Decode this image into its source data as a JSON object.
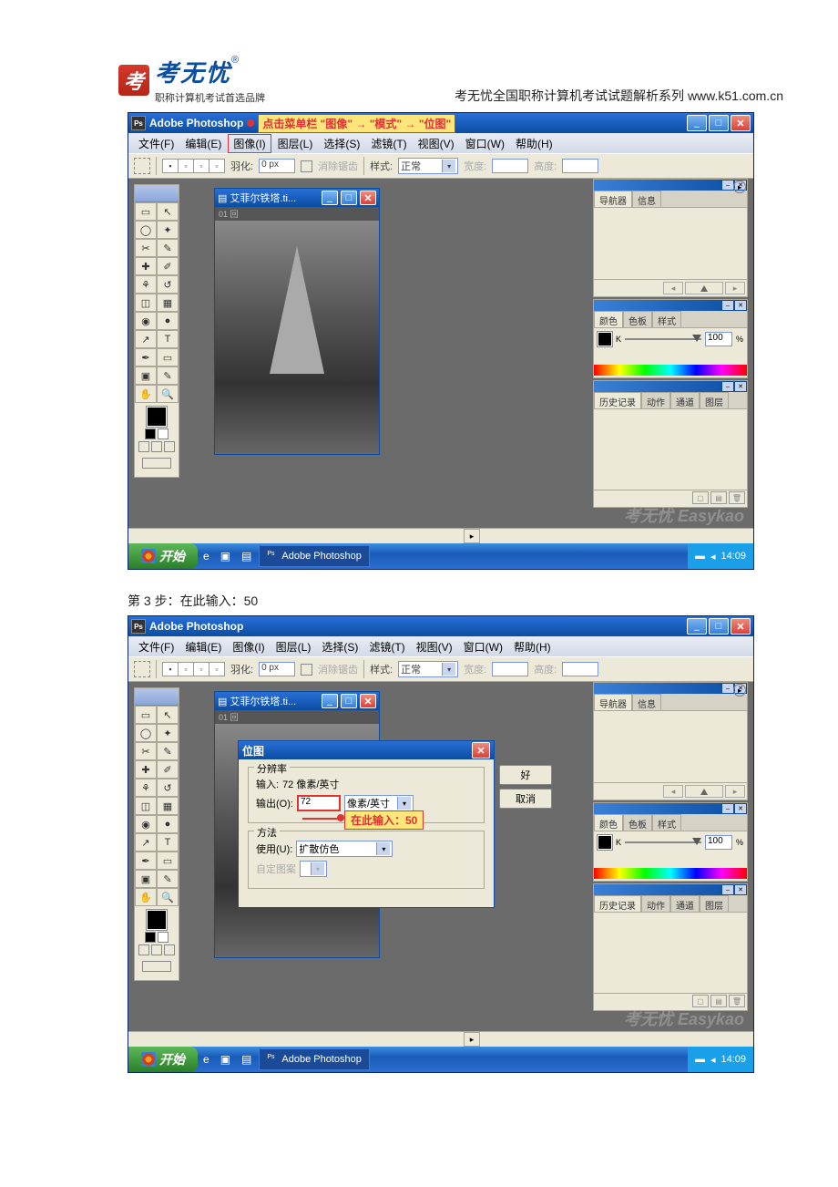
{
  "header": {
    "brand_char": "考",
    "brand_name": "考无忧",
    "reg_mark": "®",
    "slogan": "职称计算机考试首选品牌",
    "series": "考无忧全国职称计算机考试试题解析系列 www.k51.com.cn"
  },
  "step_text": "第 3 步：在此输入：50",
  "screenshot1": {
    "title": "Adobe Photoshop",
    "callout": "点击菜单栏 \"图像\" → \"模式\" → \"位图\"",
    "menus": [
      "文件(F)",
      "编辑(E)",
      "图像(I)",
      "图层(L)",
      "选择(S)",
      "滤镜(T)",
      "视图(V)",
      "窗口(W)",
      "帮助(H)"
    ],
    "highlighted_menu_index": 2,
    "options": {
      "feather_label": "羽化:",
      "feather_val": "0 px",
      "antialias": "消除锯齿",
      "style_label": "样式:",
      "style_val": "正常",
      "width_label": "宽度:",
      "height_label": "高度:"
    },
    "document": {
      "title": "艾菲尔铁塔.ti...",
      "meta": "01 回"
    },
    "panels": {
      "nav": {
        "tabs": [
          "导航器",
          "信息"
        ]
      },
      "color": {
        "tabs": [
          "颜色",
          "色板",
          "样式"
        ],
        "channel": "K",
        "value": "100",
        "unit": "%"
      },
      "history": {
        "tabs": [
          "历史记录",
          "动作",
          "通道",
          "图层"
        ]
      }
    },
    "watermark": "考无忧 Easykao",
    "taskbar": {
      "start": "开始",
      "app": "Adobe Photoshop",
      "time": "14:09"
    }
  },
  "screenshot2": {
    "title": "Adobe Photoshop",
    "menus": [
      "文件(F)",
      "编辑(E)",
      "图像(I)",
      "图层(L)",
      "选择(S)",
      "滤镜(T)",
      "视图(V)",
      "窗口(W)",
      "帮助(H)"
    ],
    "options": {
      "feather_label": "羽化:",
      "feather_val": "0 px",
      "antialias": "消除锯齿",
      "style_label": "样式:",
      "style_val": "正常",
      "width_label": "宽度:",
      "height_label": "高度:"
    },
    "document": {
      "title": "艾菲尔铁塔.ti...",
      "meta": "01 回"
    },
    "dialog": {
      "title": "位图",
      "ok": "好",
      "cancel": "取消",
      "resolution_legend": "分辨率",
      "input_label": "输入:",
      "input_val": "72 像素/英寸",
      "output_label": "输出(O):",
      "output_val": "72",
      "output_unit": "像素/英寸",
      "callout": "在此输入：50",
      "method_legend": "方法",
      "use_label": "使用(U):",
      "use_val": "扩散仿色",
      "custom_label": "自定图案"
    },
    "panels": {
      "nav": {
        "tabs": [
          "导航器",
          "信息"
        ]
      },
      "color": {
        "tabs": [
          "颜色",
          "色板",
          "样式"
        ],
        "channel": "K",
        "value": "100",
        "unit": "%"
      },
      "history": {
        "tabs": [
          "历史记录",
          "动作",
          "通道",
          "图层"
        ]
      }
    },
    "watermark": "考无忧 Easykao",
    "taskbar": {
      "start": "开始",
      "app": "Adobe Photoshop",
      "time": "14:09"
    }
  }
}
